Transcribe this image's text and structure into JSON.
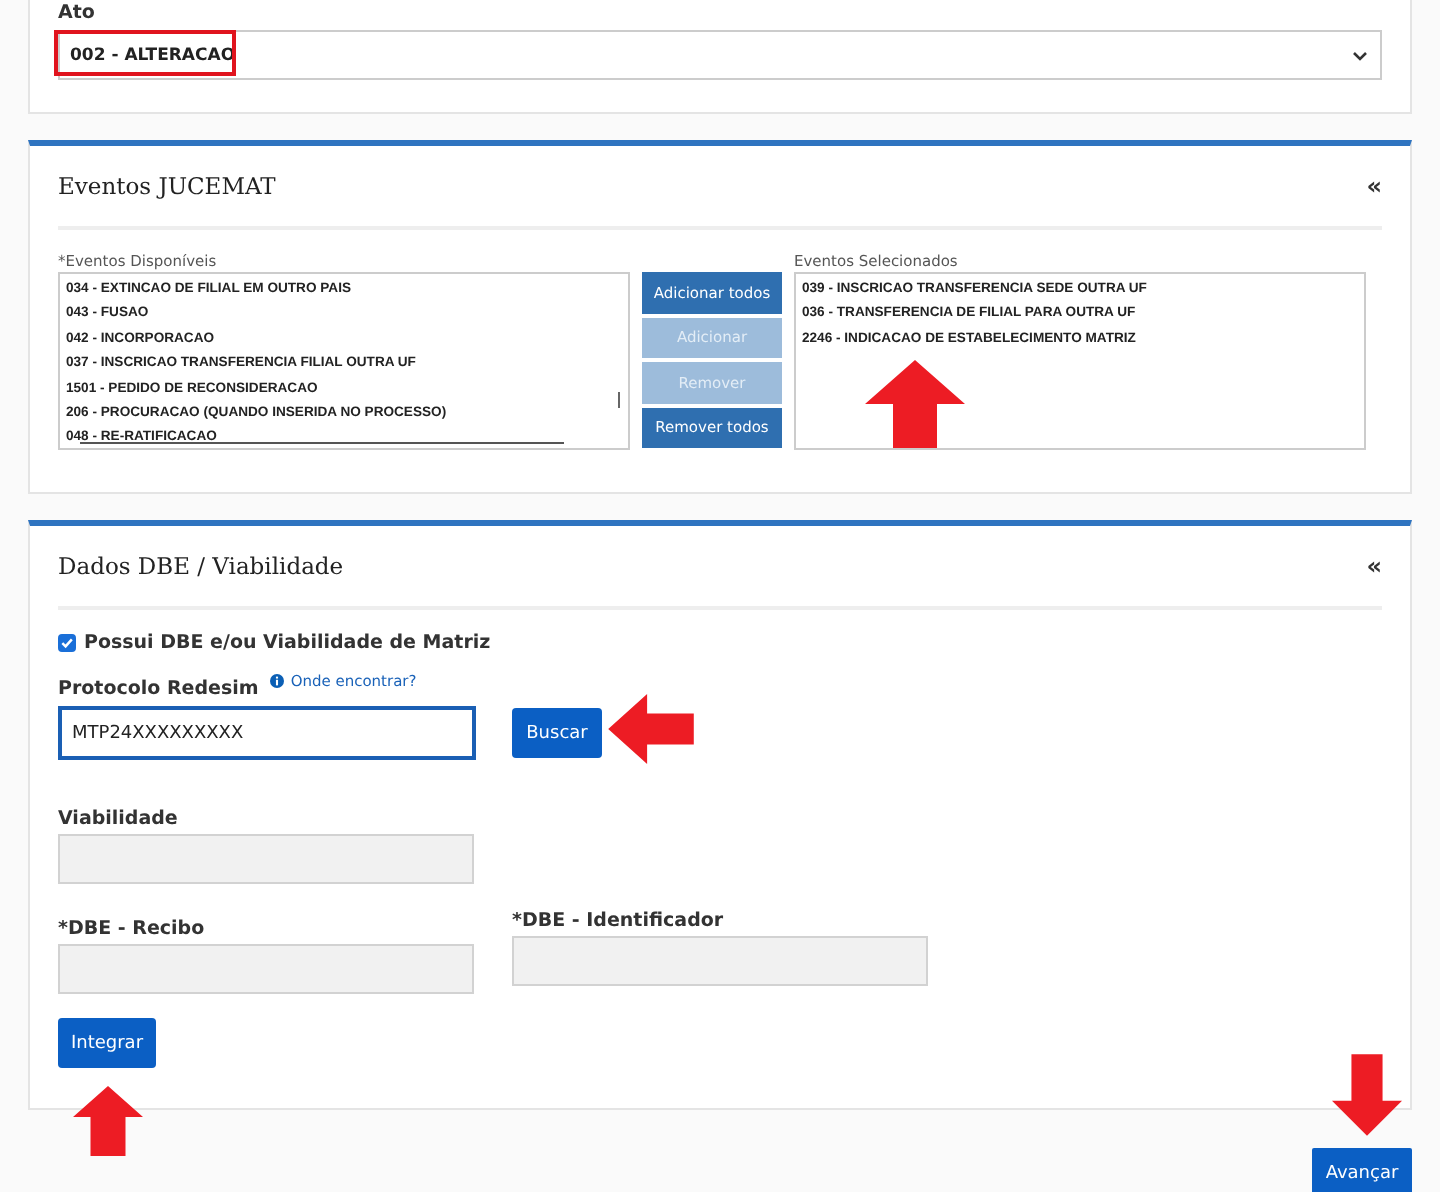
{
  "ato": {
    "label": "Ato",
    "value": "002 - ALTERACAO"
  },
  "eventos": {
    "title": "Eventos JUCEMAT",
    "collapse": "«",
    "available_label": "*Eventos Disponíveis",
    "available": [
      "034 - EXTINCAO DE FILIAL EM OUTRO PAIS",
      "043 - FUSAO",
      "042 - INCORPORACAO",
      "037 - INSCRICAO TRANSFERENCIA FILIAL OUTRA UF",
      "1501 - PEDIDO DE RECONSIDERACAO",
      "206 - PROCURACAO (QUANDO INSERIDA NO PROCESSO)",
      "048 - RE-RATIFICACAO"
    ],
    "buttons": [
      {
        "label": "Adicionar todos",
        "disabled": false
      },
      {
        "label": "Adicionar",
        "disabled": true
      },
      {
        "label": "Remover",
        "disabled": true
      },
      {
        "label": "Remover todos",
        "disabled": false
      }
    ],
    "selected_label": "Eventos Selecionados",
    "selected_events": [
      "039 - INSCRICAO TRANSFERENCIA SEDE OUTRA UF",
      "036 - TRANSFERENCIA DE FILIAL PARA OUTRA UF",
      "2246 - INDICACAO DE ESTABELECIMENTO MATRIZ"
    ]
  },
  "dbe": {
    "title": "Dados DBE / Viabilidade",
    "collapse": "«",
    "checkbox": {
      "label": "Possui DBE e/ou Viabilidade de Matriz",
      "checked": true
    },
    "protocolo": {
      "label": "Protocolo Redesim",
      "help": "Onde encontrar?",
      "value": "MTP24XXXXXXXXX"
    },
    "search_button": "Buscar",
    "viabilidade": {
      "label": "Viabilidade"
    },
    "recibo": {
      "label": "*DBE - Recibo"
    },
    "identificador": {
      "label": "*DBE - Identificador"
    },
    "integrate_button": "Integrar"
  },
  "next_button": "Avançar"
}
